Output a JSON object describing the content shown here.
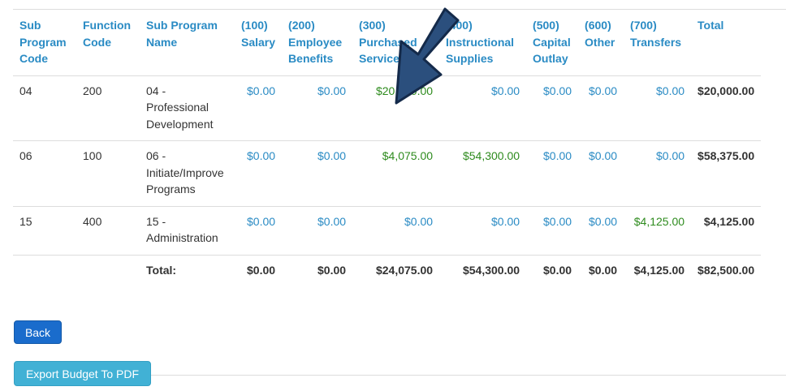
{
  "table": {
    "headers": [
      [
        "Sub",
        "Program",
        "Code"
      ],
      [
        "Function",
        "Code"
      ],
      [
        "Sub Program",
        "Name"
      ],
      [
        "(100)",
        "Salary"
      ],
      [
        "(200)",
        "Employee",
        "Benefits"
      ],
      [
        "(300)",
        "Purchased",
        "Services"
      ],
      [
        "(400)",
        "Instructional",
        "Supplies"
      ],
      [
        "(500)",
        "Capital",
        "Outlay"
      ],
      [
        "(600)",
        "Other"
      ],
      [
        "(700)",
        "Transfers"
      ],
      [
        "Total"
      ]
    ],
    "rows": [
      {
        "code": "04",
        "function": "200",
        "name": [
          "04 -",
          "Professional",
          "Development"
        ],
        "salary": "$0.00",
        "benefits": "$0.00",
        "services": "$20,000.00",
        "supplies": "$0.00",
        "capital": "$0.00",
        "other": "$0.00",
        "transfers": "$0.00",
        "total": "$20,000.00"
      },
      {
        "code": "06",
        "function": "100",
        "name": [
          "06 -",
          "Initiate/Improve",
          "Programs"
        ],
        "salary": "$0.00",
        "benefits": "$0.00",
        "services": "$4,075.00",
        "supplies": "$54,300.00",
        "capital": "$0.00",
        "other": "$0.00",
        "transfers": "$0.00",
        "total": "$58,375.00"
      },
      {
        "code": "15",
        "function": "400",
        "name": [
          "15 -",
          "Administration"
        ],
        "salary": "$0.00",
        "benefits": "$0.00",
        "services": "$0.00",
        "supplies": "$0.00",
        "capital": "$0.00",
        "other": "$0.00",
        "transfers": "$4,125.00",
        "total": "$4,125.00"
      }
    ],
    "totals": {
      "label": "Total:",
      "salary": "$0.00",
      "benefits": "$0.00",
      "services": "$24,075.00",
      "supplies": "$54,300.00",
      "capital": "$0.00",
      "other": "$0.00",
      "transfers": "$4,125.00",
      "total": "$82,500.00"
    }
  },
  "buttons": {
    "back": "Back",
    "export_pdf": "Export Budget To PDF"
  },
  "annotation": {
    "icon": "arrow-down-left-icon",
    "fill": "#2b4f7d",
    "stroke": "#142a4a"
  },
  "colors": {
    "link_blue": "#2a8bc4",
    "amount_green": "#2e8b1e",
    "back_button": "#1a6ccc",
    "export_button": "#41b1d5"
  }
}
